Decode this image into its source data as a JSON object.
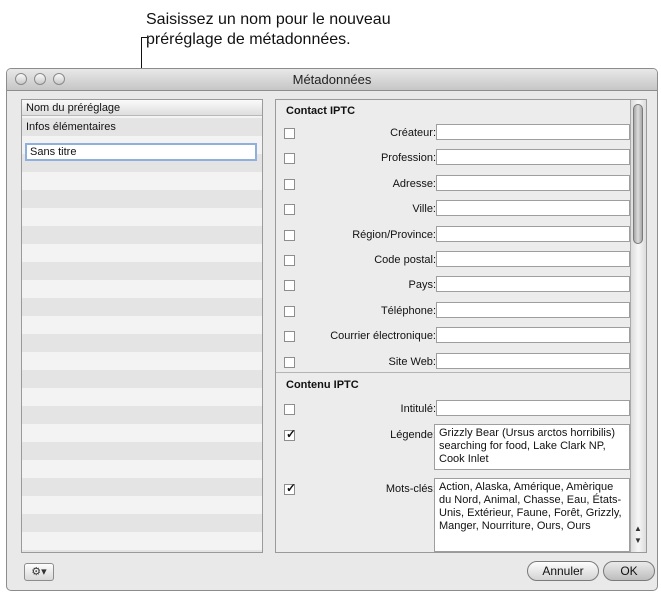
{
  "callout": {
    "line1": "Saisissez un nom pour le nouveau",
    "line2": "préréglage de métadonnées."
  },
  "window": {
    "title": "Métadonnées"
  },
  "left_pane": {
    "header": "Nom du préréglage",
    "items": [
      "Infos élémentaires"
    ],
    "editing_value": "Sans titre"
  },
  "contact_section": {
    "title": "Contact IPTC",
    "fields": [
      {
        "label": "Créateur:",
        "checked": false
      },
      {
        "label": "Profession:",
        "checked": false
      },
      {
        "label": "Adresse:",
        "checked": false
      },
      {
        "label": "Ville:",
        "checked": false
      },
      {
        "label": "Région/Province:",
        "checked": false
      },
      {
        "label": "Code postal:",
        "checked": false
      },
      {
        "label": "Pays:",
        "checked": false
      },
      {
        "label": "Téléphone:",
        "checked": false
      },
      {
        "label": "Courrier électronique:",
        "checked": false
      },
      {
        "label": "Site Web:",
        "checked": false
      }
    ]
  },
  "content_section": {
    "title": "Contenu IPTC",
    "fields": [
      {
        "label": "Intitulé:",
        "checked": false,
        "value": ""
      },
      {
        "label": "Légende:",
        "checked": true,
        "value": "Grizzly Bear (Ursus arctos horribilis) searching for food, Lake Clark NP, Cook Inlet"
      },
      {
        "label": "Mots-clés:",
        "checked": true,
        "value": "Action, Alaska, Amérique, Amèrique du Nord, Animal, Chasse, Eau, États-Unis, Extérieur, Faune, Forêt, Grizzly, Manger, Nourriture, Ours, Ours"
      }
    ]
  },
  "buttons": {
    "cancel": "Annuler",
    "ok": "OK",
    "gear_icon": "gear-icon"
  }
}
